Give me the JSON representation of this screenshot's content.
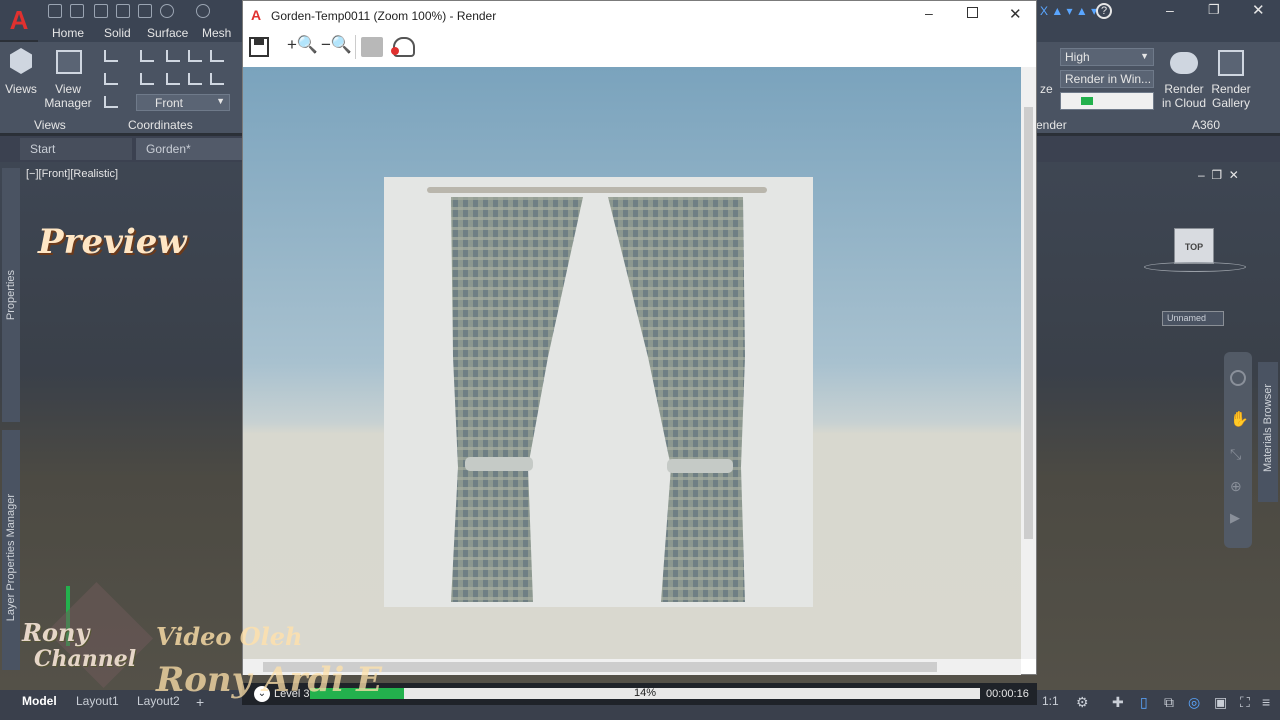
{
  "app": {
    "logo_letter": "A",
    "ribbon_tabs": [
      "Home",
      "Solid",
      "Surface",
      "Mesh"
    ],
    "panels": {
      "views_label": "Views",
      "view_manager_label": "View Manager",
      "views_btn_label": "Views",
      "coordinates_label": "Coordinates",
      "front_select": "Front",
      "render_quality": "High",
      "render_in": "Render in Win...",
      "render_in_cloud": "Render in Cloud",
      "render_gallery": "Render Gallery",
      "render_panel_label": "ender",
      "a360_label": "A360",
      "ze_label": "ze"
    },
    "doc_tabs": [
      "Start",
      "Gorden*"
    ],
    "viewport_label": "[−][Front][Realistic]",
    "side_panels": {
      "properties": "Properties",
      "layer_props": "Layer Properties Manager",
      "materials": "Materials Browser"
    },
    "viewcube": {
      "top_label": "TOP",
      "wcs_label": "Unnamed"
    },
    "layout_tabs": [
      "Model",
      "Layout1",
      "Layout2"
    ],
    "scale_label": "1:1"
  },
  "render_window": {
    "title": "Gorden-Temp0011 (Zoom 100%) - Render",
    "status": {
      "level": "Level 3",
      "percent": "14%",
      "progress": 0.14,
      "time": "00:00:16"
    }
  },
  "overlay": {
    "preview": "Preview",
    "video_by": "Video Oleh",
    "author": "Rony Ardi E",
    "channel_line1": "Rony",
    "channel_line2": "Channel"
  },
  "colors": {
    "accent_red": "#e0312f",
    "progress_green": "#23b14d",
    "ribbon_bg": "#4a5362"
  }
}
